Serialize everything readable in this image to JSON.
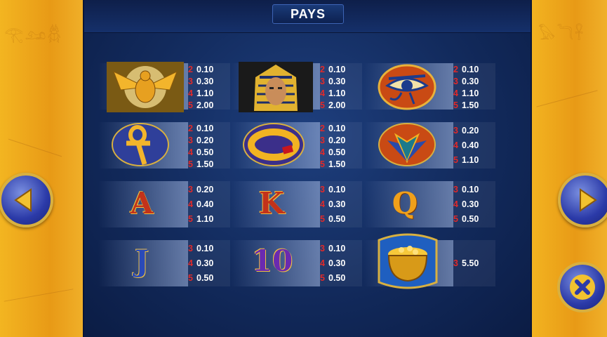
{
  "title": "PAYS",
  "symbols": [
    {
      "name": "scarab",
      "pays": [
        {
          "count": "2",
          "value": "0.10"
        },
        {
          "count": "3",
          "value": "0.30"
        },
        {
          "count": "4",
          "value": "1.10"
        },
        {
          "count": "5",
          "value": "2.00"
        }
      ]
    },
    {
      "name": "pharaoh",
      "pays": [
        {
          "count": "2",
          "value": "0.10"
        },
        {
          "count": "3",
          "value": "0.30"
        },
        {
          "count": "4",
          "value": "1.10"
        },
        {
          "count": "5",
          "value": "2.00"
        }
      ]
    },
    {
      "name": "eye-of-horus",
      "pays": [
        {
          "count": "2",
          "value": "0.10"
        },
        {
          "count": "3",
          "value": "0.30"
        },
        {
          "count": "4",
          "value": "1.10"
        },
        {
          "count": "5",
          "value": "1.50"
        }
      ]
    },
    {
      "name": "ankh",
      "pays": [
        {
          "count": "2",
          "value": "0.10"
        },
        {
          "count": "3",
          "value": "0.20"
        },
        {
          "count": "4",
          "value": "0.50"
        },
        {
          "count": "5",
          "value": "1.50"
        }
      ]
    },
    {
      "name": "ring",
      "pays": [
        {
          "count": "2",
          "value": "0.10"
        },
        {
          "count": "3",
          "value": "0.20"
        },
        {
          "count": "4",
          "value": "0.50"
        },
        {
          "count": "5",
          "value": "1.50"
        }
      ]
    },
    {
      "name": "lotus",
      "pays": [
        {
          "count": "3",
          "value": "0.20"
        },
        {
          "count": "4",
          "value": "0.40"
        },
        {
          "count": "5",
          "value": "1.10"
        }
      ]
    },
    {
      "name": "A",
      "label": "A",
      "pays": [
        {
          "count": "3",
          "value": "0.20"
        },
        {
          "count": "4",
          "value": "0.40"
        },
        {
          "count": "5",
          "value": "1.10"
        }
      ]
    },
    {
      "name": "K",
      "label": "K",
      "pays": [
        {
          "count": "3",
          "value": "0.10"
        },
        {
          "count": "4",
          "value": "0.30"
        },
        {
          "count": "5",
          "value": "0.50"
        }
      ]
    },
    {
      "name": "Q",
      "label": "Q",
      "pays": [
        {
          "count": "3",
          "value": "0.10"
        },
        {
          "count": "4",
          "value": "0.30"
        },
        {
          "count": "5",
          "value": "0.50"
        }
      ]
    },
    {
      "name": "J",
      "label": "J",
      "pays": [
        {
          "count": "3",
          "value": "0.10"
        },
        {
          "count": "4",
          "value": "0.30"
        },
        {
          "count": "5",
          "value": "0.50"
        }
      ]
    },
    {
      "name": "10",
      "label": "10",
      "pays": [
        {
          "count": "3",
          "value": "0.10"
        },
        {
          "count": "4",
          "value": "0.30"
        },
        {
          "count": "5",
          "value": "0.50"
        }
      ]
    },
    {
      "name": "gold-pot",
      "pays": [
        {
          "count": "3",
          "value": "5.50"
        }
      ]
    }
  ],
  "colors": {
    "count": "#e02a2a",
    "value": "#ffffff",
    "panel": "#122a5c",
    "side": "#f0ab1e",
    "button": "#2b3aa8",
    "button_rim": "#d8b040"
  },
  "icons": {
    "prev": "left-arrow-icon",
    "next": "right-arrow-icon",
    "close": "close-icon"
  }
}
